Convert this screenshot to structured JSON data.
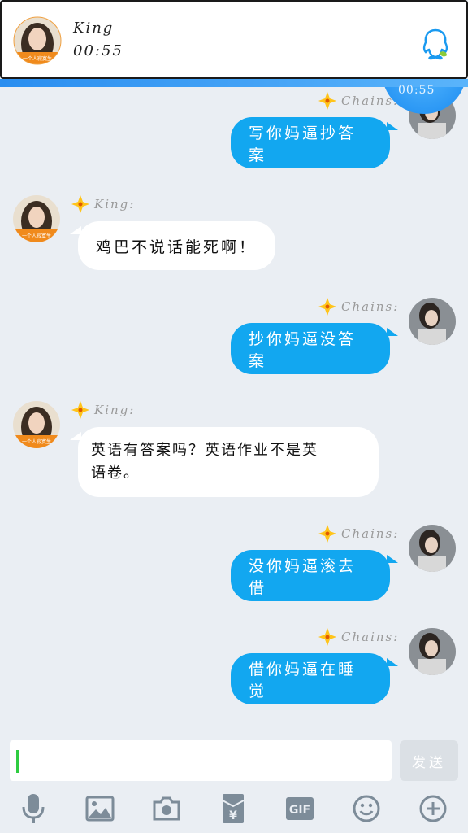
{
  "banner": {
    "name": "King",
    "time": "00:55"
  },
  "call": {
    "time": "00:55"
  },
  "messages": [
    {
      "side": "me",
      "sender": "Chains:",
      "text": "写你妈逼抄答案"
    },
    {
      "side": "other",
      "sender": "King:",
      "text": "鸡巴不说话能死啊！"
    },
    {
      "side": "me",
      "sender": "Chains:",
      "text": "抄你妈逼没答案"
    },
    {
      "side": "other",
      "sender": "King:",
      "text_line1": "英语有答案吗？英语作业不是英",
      "text_line2": "语卷。"
    },
    {
      "side": "me",
      "sender": "Chains:",
      "text": "没你妈逼滚去借"
    },
    {
      "side": "me",
      "sender": "Chains:",
      "text": "借你妈逼在睡觉"
    }
  ],
  "avatar_caption": "一个人寂寞生",
  "input": {
    "value": "",
    "send_label": "发送"
  },
  "toolbar": [
    "microphone-icon",
    "image-icon",
    "camera-icon",
    "red-packet-icon",
    "gif-icon",
    "emoji-icon",
    "plus-icon"
  ],
  "toolbar_gif_label": "GIF",
  "toolbar_yen_label": "¥",
  "colors": {
    "bubble_me": "#12a7f0",
    "bubble_other": "#ffffff",
    "background": "#eaeef3"
  }
}
